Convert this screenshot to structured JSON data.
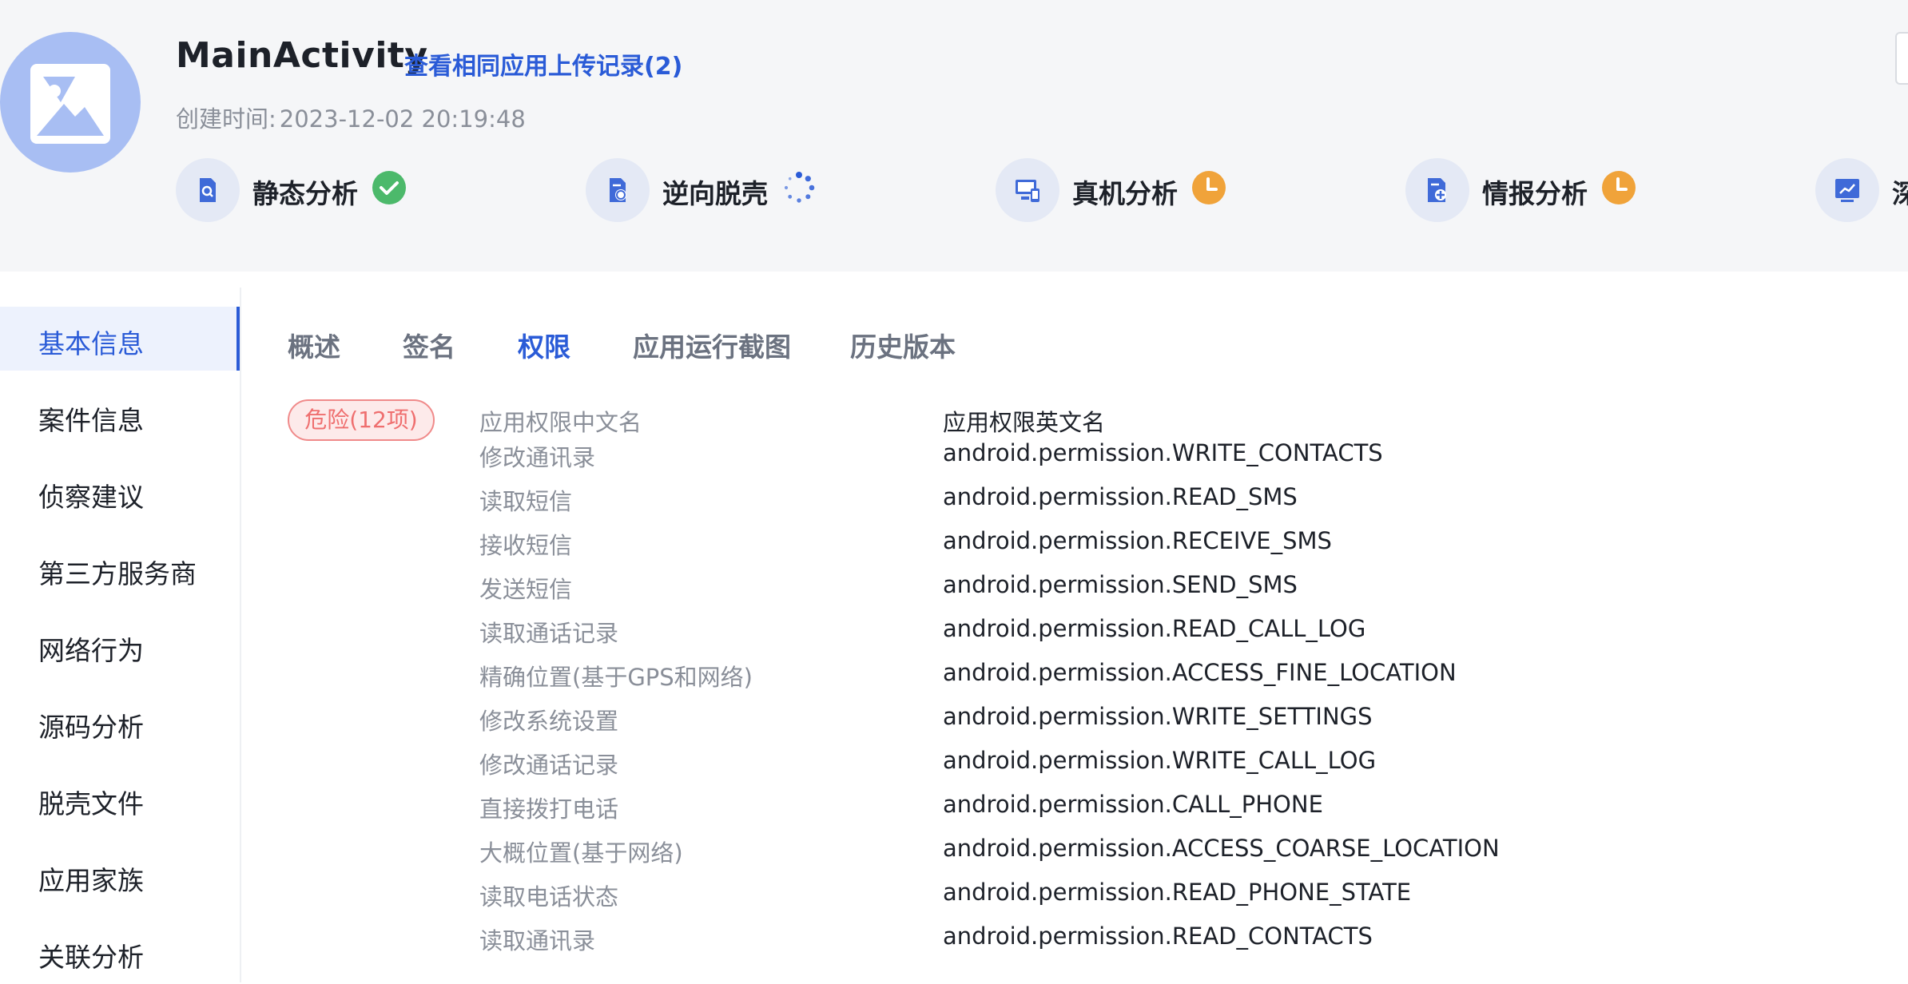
{
  "app": {
    "name": "MainActivity",
    "history_link": "查看相同应用上传记录(2)",
    "created_label": "创建时间:",
    "created_time": "2023-12-02 20:19:48"
  },
  "steps": [
    {
      "label": "静态分析",
      "icon": "doc-search-icon",
      "status": "completed"
    },
    {
      "label": "逆向脱壳",
      "icon": "doc-unpack-icon",
      "status": "in-progress"
    },
    {
      "label": "真机分析",
      "icon": "device-monitor-icon",
      "status": "pending"
    },
    {
      "label": "情报分析",
      "icon": "doc-intel-icon",
      "status": "pending"
    },
    {
      "label": "深",
      "icon": "chart-trend-icon",
      "status": "unknown"
    }
  ],
  "status_colors": {
    "completed": "#4cb96b",
    "in-progress": "#2a5bd7",
    "pending": "#f0a33a"
  },
  "sidebar": {
    "items": [
      {
        "label": "基本信息",
        "active": true
      },
      {
        "label": "案件信息",
        "active": false
      },
      {
        "label": "侦察建议",
        "active": false
      },
      {
        "label": "第三方服务商",
        "active": false
      },
      {
        "label": "网络行为",
        "active": false
      },
      {
        "label": "源码分析",
        "active": false
      },
      {
        "label": "脱壳文件",
        "active": false
      },
      {
        "label": "应用家族",
        "active": false
      },
      {
        "label": "关联分析",
        "active": false
      }
    ]
  },
  "tabs": [
    {
      "label": "概述",
      "active": false
    },
    {
      "label": "签名",
      "active": false
    },
    {
      "label": "权限",
      "active": true
    },
    {
      "label": "应用运行截图",
      "active": false
    },
    {
      "label": "历史版本",
      "active": false
    }
  ],
  "permissions": {
    "danger_badge": "危险(12项)",
    "col_cn": "应用权限中文名",
    "col_en": "应用权限英文名",
    "rows": [
      {
        "cn": "修改通讯录",
        "en": "android.permission.WRITE_CONTACTS"
      },
      {
        "cn": "读取短信",
        "en": "android.permission.READ_SMS"
      },
      {
        "cn": "接收短信",
        "en": "android.permission.RECEIVE_SMS"
      },
      {
        "cn": "发送短信",
        "en": "android.permission.SEND_SMS"
      },
      {
        "cn": "读取通话记录",
        "en": "android.permission.READ_CALL_LOG"
      },
      {
        "cn": "精确位置(基于GPS和网络)",
        "en": "android.permission.ACCESS_FINE_LOCATION"
      },
      {
        "cn": "修改系统设置",
        "en": "android.permission.WRITE_SETTINGS"
      },
      {
        "cn": "修改通话记录",
        "en": "android.permission.WRITE_CALL_LOG"
      },
      {
        "cn": "直接拨打电话",
        "en": "android.permission.CALL_PHONE"
      },
      {
        "cn": "大概位置(基于网络)",
        "en": "android.permission.ACCESS_COARSE_LOCATION"
      },
      {
        "cn": "读取电话状态",
        "en": "android.permission.READ_PHONE_STATE"
      },
      {
        "cn": "读取通讯录",
        "en": "android.permission.READ_CONTACTS"
      }
    ]
  }
}
